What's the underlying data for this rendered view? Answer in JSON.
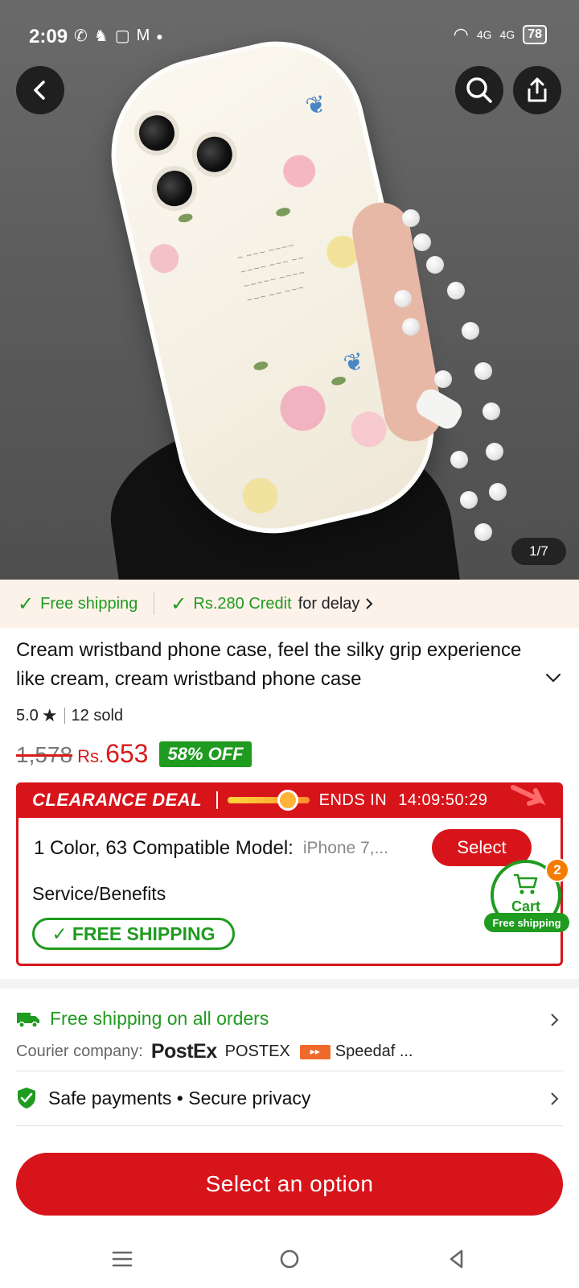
{
  "status_bar": {
    "time": "2:09",
    "battery": "78",
    "network": "4G"
  },
  "product_image": {
    "counter": "1/7"
  },
  "shipping_banner": {
    "free_shipping": "Free shipping",
    "credit": "Rs.280 Credit",
    "credit_suffix": "for delay"
  },
  "product": {
    "title": "Cream wristband phone case, feel the silky grip experience like cream, cream wristband phone case",
    "rating": "5.0",
    "sold": "12 sold",
    "old_price": "1,578",
    "currency": "Rs.",
    "price": "653",
    "discount": "58% OFF"
  },
  "deal": {
    "title": "CLEARANCE DEAL",
    "ends_label": "ENDS IN",
    "countdown": "14:09:50:29",
    "progress": 0.8
  },
  "options": {
    "label": "1 Color, 63 Compatible Model:",
    "value": "iPhone 7,...",
    "select_label": "Select",
    "service_label": "Service/Benefits",
    "free_shipping_pill": "FREE SHIPPING"
  },
  "cart": {
    "label": "Cart",
    "count": "2",
    "ship_tag": "Free shipping"
  },
  "shipping_info": {
    "title": "Free shipping on all orders",
    "courier_label": "Courier company:",
    "courier_logo": "PostEx",
    "courier_1": "POSTEX",
    "courier_2": "Speedaf ..."
  },
  "safety": {
    "label": "Safe payments • Secure privacy"
  },
  "cta": {
    "label": "Select an option"
  },
  "colors": {
    "accent": "#d8141b",
    "green": "#1f9b1f"
  }
}
